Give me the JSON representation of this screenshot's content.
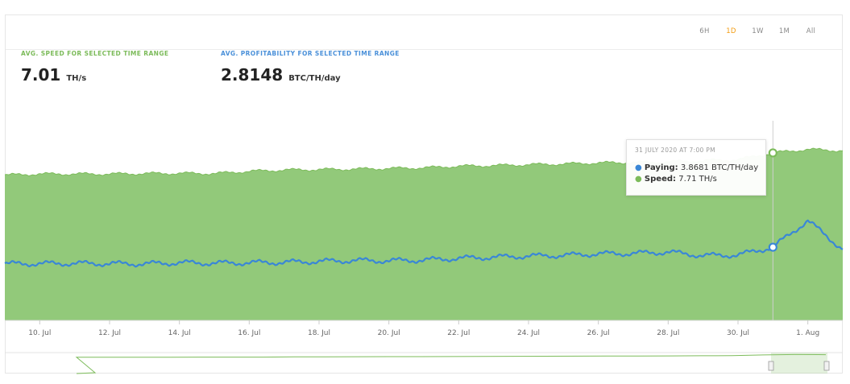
{
  "range_tabs": [
    {
      "label": "6H",
      "active": false
    },
    {
      "label": "1D",
      "active": true
    },
    {
      "label": "1W",
      "active": false
    },
    {
      "label": "1M",
      "active": false
    },
    {
      "label": "All",
      "active": false
    }
  ],
  "stats": {
    "speed": {
      "label": "AVG. SPEED FOR SELECTED TIME RANGE",
      "value": "7.01",
      "unit": "TH/s"
    },
    "profitability": {
      "label": "AVG. PROFITABILITY FOR SELECTED TIME RANGE",
      "value": "2.8148",
      "unit": "BTC/TH/day"
    }
  },
  "tooltip": {
    "date": "31 JULY 2020 AT 7:00 PM",
    "paying_name": "Paying:",
    "paying_value": "3.8681 BTC/TH/day",
    "speed_name": "Speed:",
    "speed_value": "7.71 TH/s"
  },
  "colors": {
    "speed_fill": "#92c97a",
    "speed_edge": "#7cbb5a",
    "paying_line": "#3a87d6",
    "accent_active": "#f39c12"
  },
  "chart_data": {
    "type": "area",
    "x_ticks": [
      "10. Jul",
      "12. Jul",
      "14. Jul",
      "16. Jul",
      "18. Jul",
      "20. Jul",
      "22. Jul",
      "24. Jul",
      "26. Jul",
      "28. Jul",
      "30. Jul",
      "1. Aug"
    ],
    "series": [
      {
        "name": "Speed",
        "type": "area",
        "x": [
          "9 Jul",
          "10 Jul",
          "11 Jul",
          "12 Jul",
          "13 Jul",
          "14 Jul",
          "15 Jul",
          "16 Jul",
          "17 Jul",
          "18 Jul",
          "19 Jul",
          "20 Jul",
          "21 Jul",
          "22 Jul",
          "23 Jul",
          "24 Jul",
          "25 Jul",
          "26 Jul",
          "27 Jul",
          "28 Jul",
          "29 Jul",
          "30 Jul",
          "31 Jul",
          "1 Aug",
          "2 Aug"
        ],
        "values": [
          6.55,
          6.6,
          6.6,
          6.6,
          6.62,
          6.63,
          6.62,
          6.72,
          6.78,
          6.8,
          6.82,
          6.85,
          6.88,
          6.95,
          6.98,
          7.02,
          7.05,
          7.1,
          7.12,
          7.15,
          7.2,
          7.25,
          7.55,
          7.71,
          7.65
        ]
      },
      {
        "name": "Paying",
        "type": "line",
        "x": [
          "9 Jul",
          "10 Jul",
          "11 Jul",
          "12 Jul",
          "13 Jul",
          "14 Jul",
          "15 Jul",
          "16 Jul",
          "17 Jul",
          "18 Jul",
          "19 Jul",
          "20 Jul",
          "21 Jul",
          "22 Jul",
          "23 Jul",
          "24 Jul",
          "25 Jul",
          "26 Jul",
          "27 Jul",
          "28 Jul",
          "29 Jul",
          "30 Jul",
          "31 Jul",
          "1 Aug",
          "2 Aug"
        ],
        "values": [
          2.55,
          2.56,
          2.57,
          2.56,
          2.55,
          2.6,
          2.58,
          2.6,
          2.62,
          2.66,
          2.7,
          2.69,
          2.72,
          2.8,
          2.85,
          2.9,
          2.93,
          3.0,
          3.02,
          3.08,
          2.92,
          2.95,
          3.3,
          4.5,
          3.2
        ]
      }
    ],
    "ylim": [
      0,
      9
    ],
    "grid": false,
    "legend": "tooltip"
  }
}
